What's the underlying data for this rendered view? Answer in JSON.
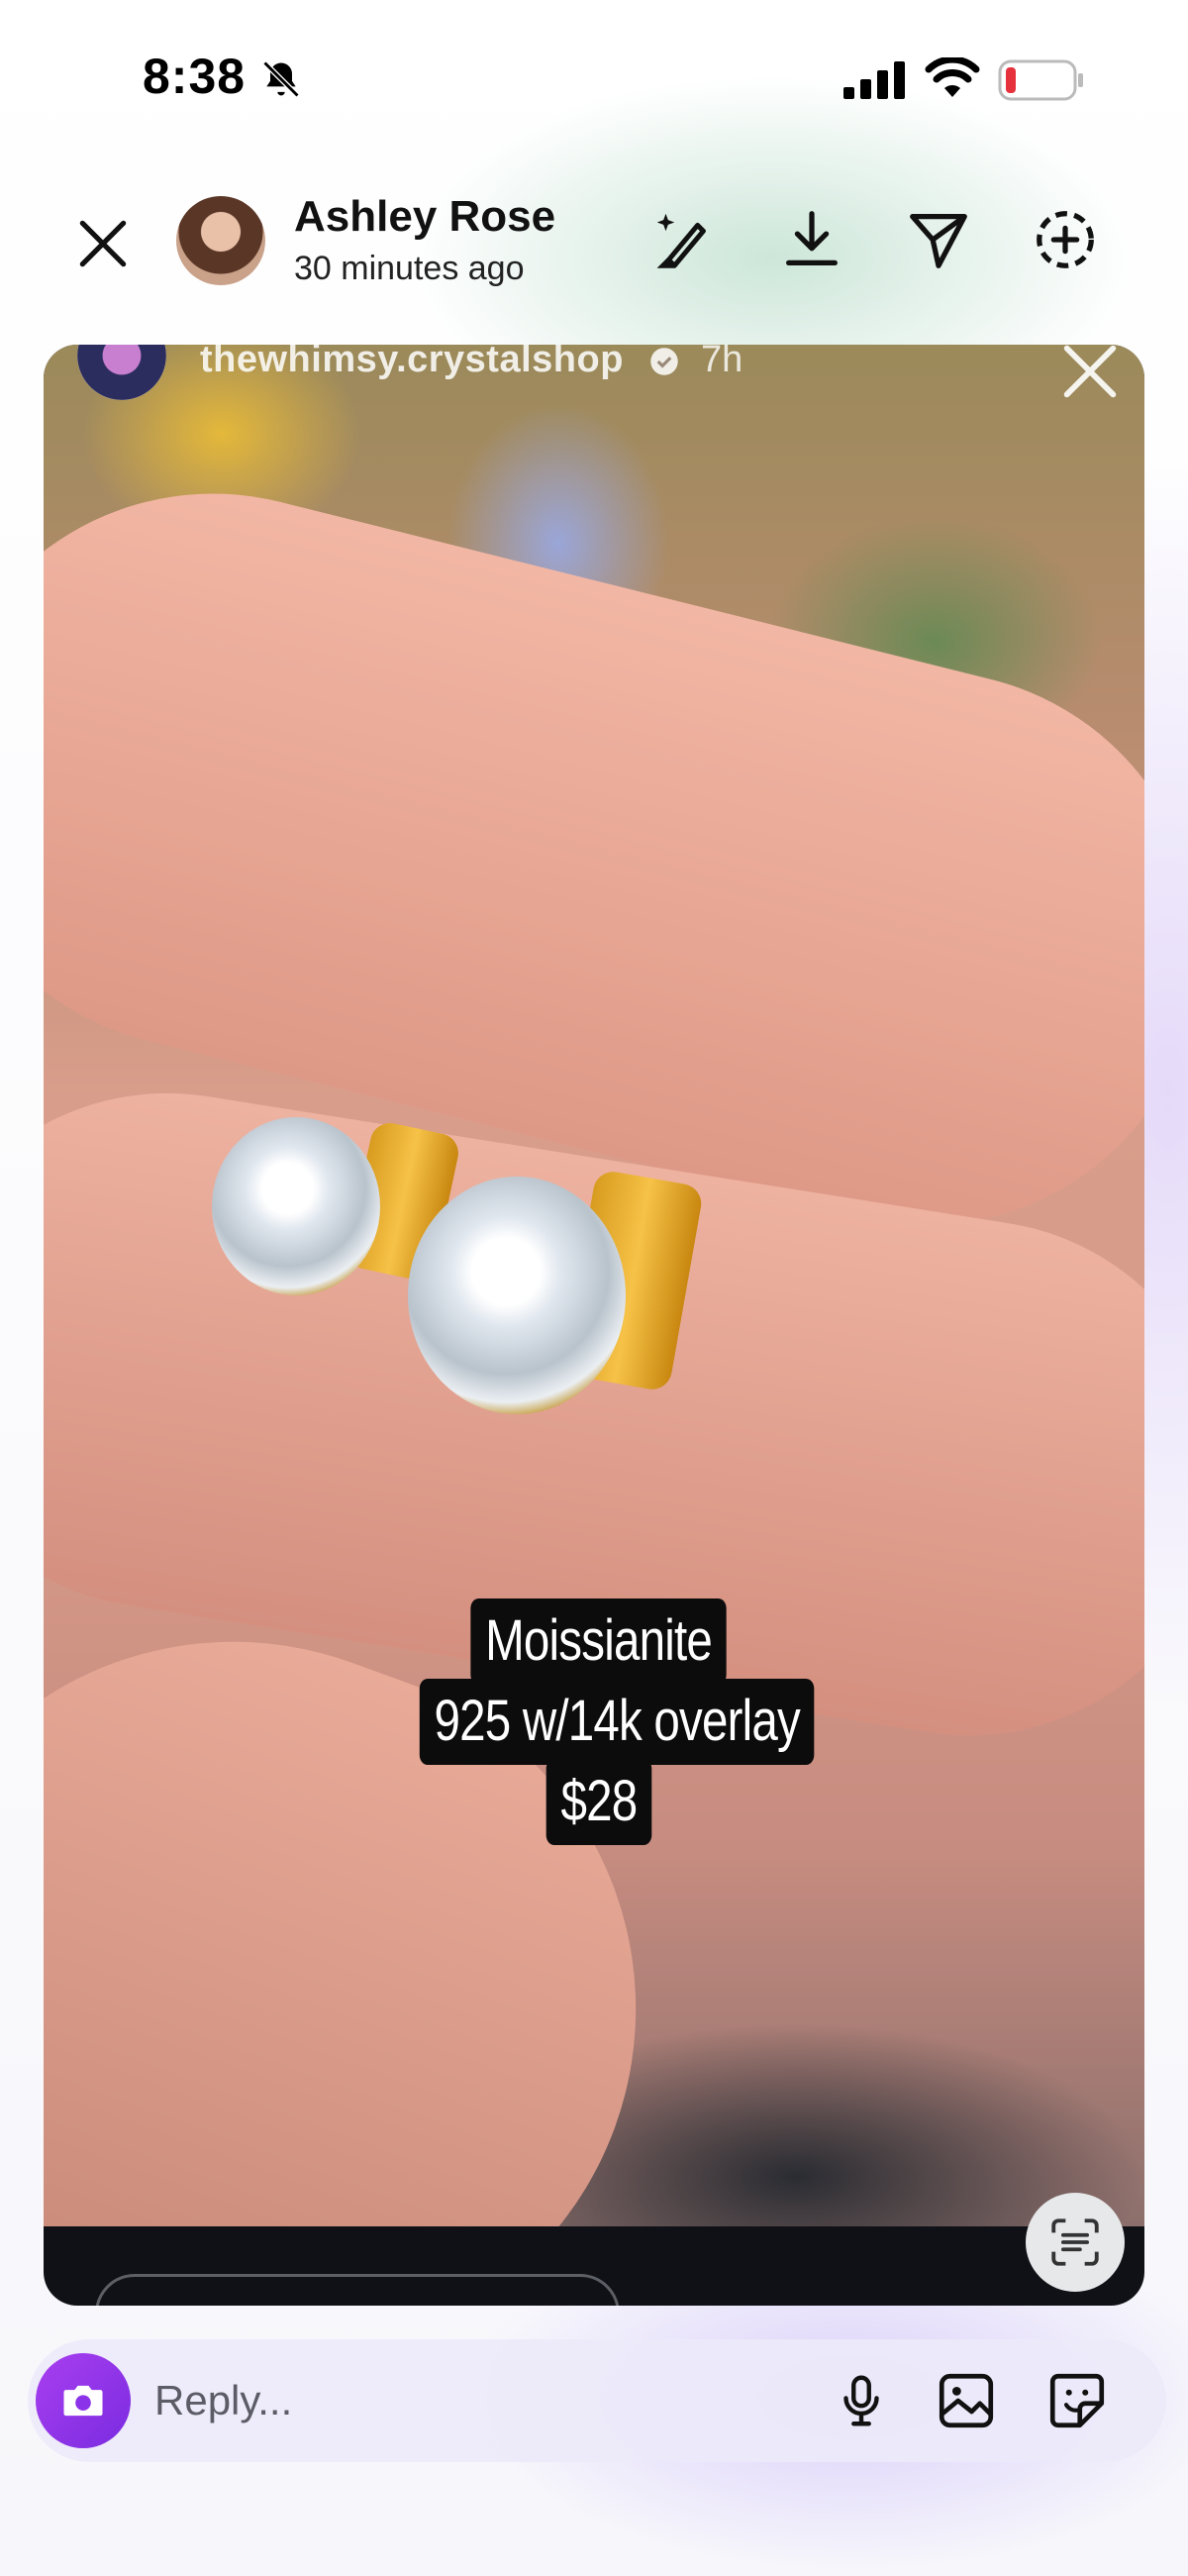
{
  "status_bar": {
    "time": "8:38",
    "icons": [
      "bell-slash-icon",
      "cellular-signal-icon",
      "wifi-icon",
      "battery-low-icon"
    ]
  },
  "header": {
    "user_name": "Ashley Rose",
    "posted_time": "30 minutes ago",
    "buttons": [
      "close-icon",
      "sparkle-brush-icon",
      "download-icon",
      "send-icon",
      "add-circle-icon"
    ]
  },
  "story": {
    "shop_name": "thewhimsy.crystalshop",
    "shop_time": "7h",
    "caption": {
      "line1": "Moissianite",
      "line2": "925 w/14k overlay",
      "line3": "$28"
    }
  },
  "reply": {
    "placeholder": "Reply...",
    "icons": [
      "camera-icon",
      "microphone-icon",
      "gallery-icon",
      "sticker-icon"
    ]
  },
  "colors": {
    "accent": "#9a38ee",
    "battery_low": "#e5323d"
  }
}
